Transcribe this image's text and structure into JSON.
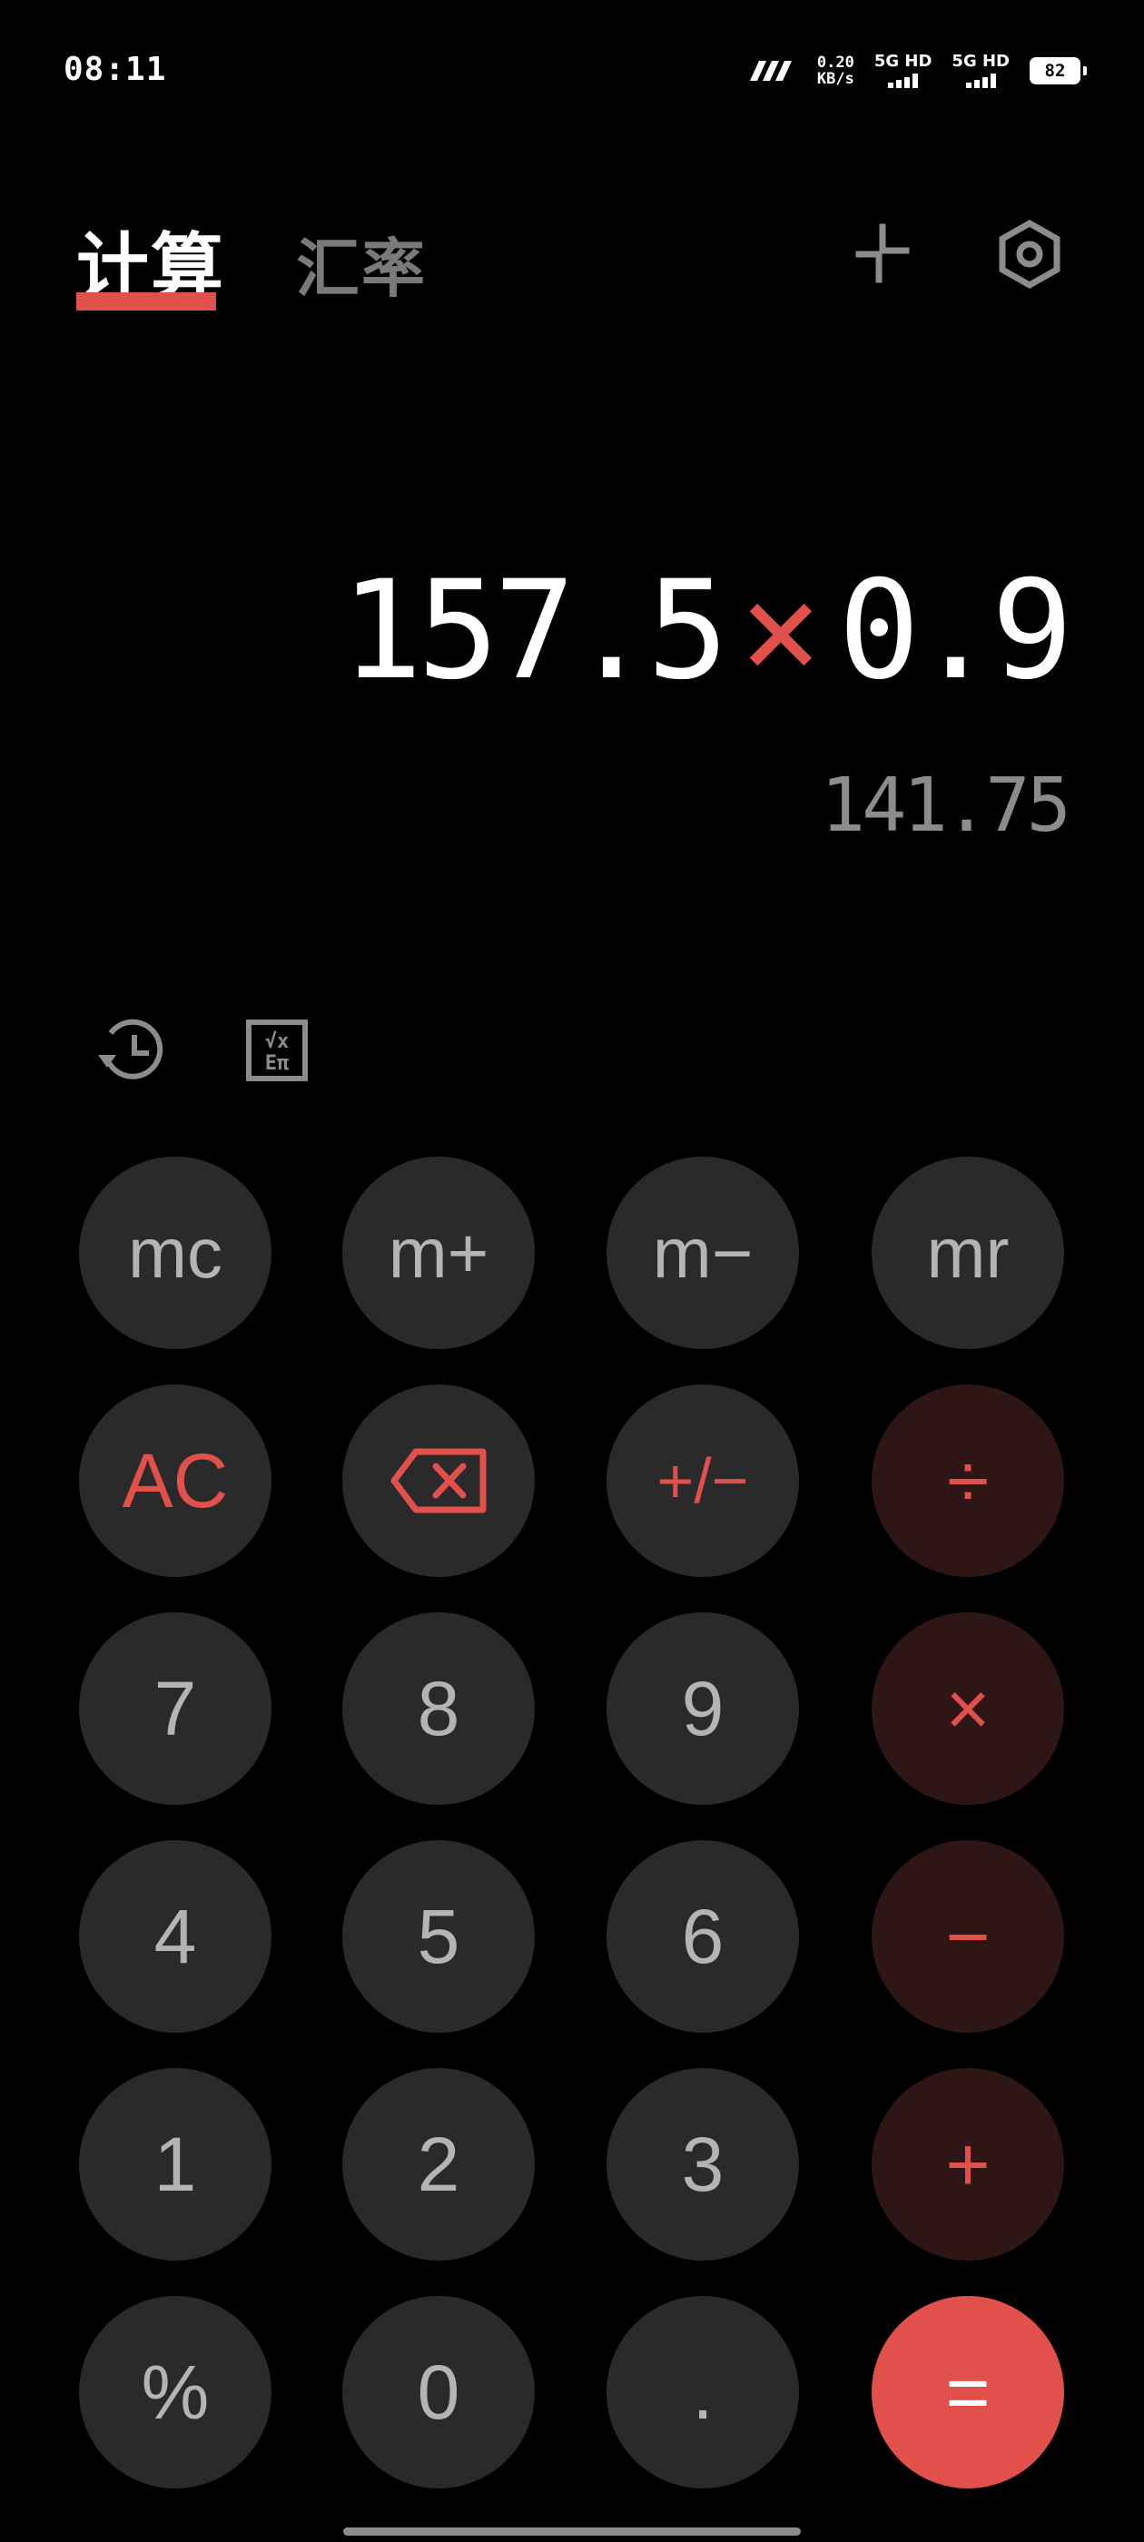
{
  "status": {
    "time": "08:11",
    "net_speed_top": "0.20",
    "net_speed_bottom": "KB/s",
    "sim1": "5G HD",
    "sim2": "5G HD",
    "battery": "82"
  },
  "tabs": [
    {
      "label": "计算"
    },
    {
      "label": "汇率"
    }
  ],
  "display": {
    "operand1": "157.5",
    "operator": "×",
    "operand2": "0.9",
    "result": "141.75"
  },
  "keys": {
    "mc": "mc",
    "mplus": "m+",
    "mminus": "m−",
    "mr": "mr",
    "ac": "AC",
    "sign": "+/−",
    "divide": "÷",
    "seven": "7",
    "eight": "8",
    "nine": "9",
    "multiply": "×",
    "four": "4",
    "five": "5",
    "six": "6",
    "minus": "−",
    "one": "1",
    "two": "2",
    "three": "3",
    "plus": "+",
    "percent": "%",
    "zero": "0",
    "dot": ".",
    "equals": "="
  },
  "icons": {
    "collapse": "collapse-icon",
    "settings": "settings-icon",
    "history": "history-icon",
    "scientific": "scientific-icon",
    "backspace": "backspace-icon"
  },
  "colors": {
    "accent": "#e2504c",
    "key_bg": "#2a2a2a",
    "operator_bg": "#2e1616"
  }
}
